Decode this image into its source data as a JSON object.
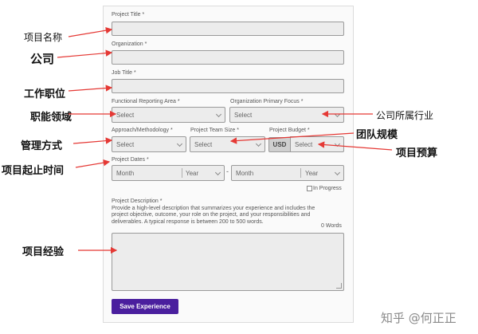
{
  "form": {
    "project_title": {
      "label": "Project Title *"
    },
    "organization": {
      "label": "Organization *"
    },
    "job_title": {
      "label": "Job Title *"
    },
    "functional_area": {
      "label": "Functional Reporting Area *",
      "value": "Select"
    },
    "primary_focus": {
      "label": "Organization Primary Focus *",
      "value": "Select"
    },
    "methodology": {
      "label": "Approach/Methodology *",
      "value": "Select"
    },
    "team_size": {
      "label": "Project Team Size *",
      "value": "Select"
    },
    "budget": {
      "label": "Project Budget *",
      "currency": "USD",
      "value": "Select"
    },
    "dates": {
      "label": "Project Dates *",
      "start_month": "Month",
      "start_year": "Year",
      "separator": "-",
      "end_month": "Month",
      "end_year": "Year",
      "in_progress": "In Progress"
    },
    "description": {
      "label": "Project Description *",
      "help": "Provide a high-level description that summarizes your experience and includes the project objective, outcome, your role on the project, and your responsibilities and deliverables. A typical response is between 200 to 500 words.",
      "word_count": "0 Words"
    },
    "save_label": "Save Experience"
  },
  "annotations": {
    "project_name": "项目名称",
    "company": "公司",
    "job_position": "工作职位",
    "functional_field": "职能领域",
    "company_industry": "公司所属行业",
    "team_size": "团队规模",
    "management_style": "管理方式",
    "project_budget": "项目预算",
    "project_period": "项目起止时间",
    "project_experience": "项目经验"
  },
  "watermark": "知乎 @何正正",
  "colors": {
    "button": "#4a1f9e",
    "arrow": "#e53935",
    "field": "#ececec"
  }
}
